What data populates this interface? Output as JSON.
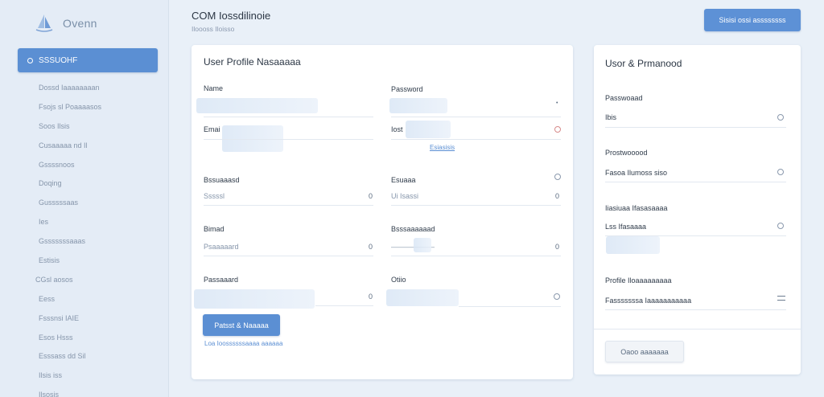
{
  "brand": {
    "name": "Ovenn"
  },
  "sidebar": {
    "active": "SSSUOHF",
    "items": [
      "Dossd Iaaaaaaaan",
      "Fsojs sl Poaaaasos",
      "Soos Ilsis",
      "Cusaaaaa nd Il",
      "Gssssnoos",
      "Doqing",
      "Gusssssaas",
      "Ies",
      "Gsssssssaaas",
      "Estisis",
      "CGsl aosos",
      "Eess",
      "Fsssnsi IAIE",
      "Esos Hsss",
      "Esssass dd Sil",
      "Ilsis iss",
      "Ilsosis"
    ]
  },
  "header": {
    "title": "COM Iossdilinoie",
    "subtitle": "Iloooss Iloisso",
    "button": "Sisisi ossi assssssss"
  },
  "profile": {
    "title": "User Profile Nasaaaaa",
    "fields": {
      "name_label": "Name",
      "password_label": "Password",
      "email_label": "Emai",
      "lost_label": "Iost",
      "lost_link": "Esiasisis",
      "username_label": "Bssuaaasd",
      "username_value": "Sssssl",
      "zero": "0",
      "source_label": "Esuaaa",
      "source_value": "Ui Isassi",
      "email2_label": "Bimad",
      "email2_value": "Psaaaaard",
      "passfield_label": "Bsssaaaaaad",
      "passfield_value": "——————",
      "password2_label": "Passaaard",
      "other_label": "Otiio"
    },
    "save_button": "Patsst & Naaaaa",
    "footer_link": "Loa Ioossssssaaaa aaaaaa"
  },
  "side": {
    "title": "Usor & Prmanood",
    "fields": [
      {
        "label": "Passwoaad",
        "value": "Ibis",
        "icon": "settings-icon"
      },
      {
        "label": "Prostwooood",
        "value": "Fasoa Ilumoss siso",
        "icon": "settings-icon"
      },
      {
        "label": "Iiasiuaa Ifasasaaaa",
        "value": "Lss Ifasaaaa",
        "icon": "settings-icon"
      },
      {
        "label": "Profile Iloaaaaaaaaa",
        "value": "Fasssssssa Iaaaaaaaaaaa",
        "icon": "menu-icon"
      }
    ],
    "button": "Oaoo aaaaaaa"
  }
}
